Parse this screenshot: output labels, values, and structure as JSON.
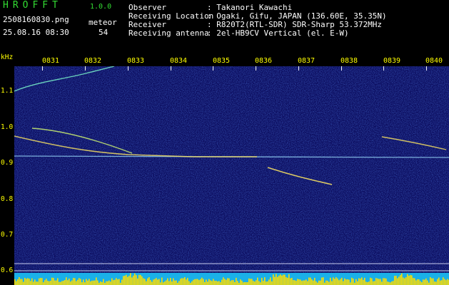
{
  "header": {
    "logo": "HROFFT",
    "version": "1.0.0",
    "filename": "2508160830.png",
    "datetime": "25.08.16 08:30",
    "meteor_label": "meteor",
    "meteor_count": "54",
    "fields": [
      {
        "label": "Observer",
        "value": ": Takanori Kawachi"
      },
      {
        "label": "Receiving Location",
        "value": ": Ogaki, Gifu, JAPAN (136.60E, 35.35N)"
      },
      {
        "label": "Receiver",
        "value": ": R820T2(RTL-SDR) SDR-Sharp 53.372MHz"
      },
      {
        "label": "Receiving antenna",
        "value": ": 2el-HB9CV Vertical (el. E-W)"
      }
    ]
  },
  "axis": {
    "unit": "kHz",
    "y_ticks": [
      "1.1",
      "1.0",
      "0.9",
      "0.8",
      "0.7",
      "0.6"
    ],
    "x_ticks": [
      "0831",
      "0832",
      "0833",
      "0834",
      "0835",
      "0836",
      "0837",
      "0838",
      "0839",
      "0840"
    ]
  },
  "colors": {
    "background": "#000000",
    "spectrogram_bg": "#0a0a6a",
    "text_yellow": "#ffff00",
    "text_white": "#ffffff",
    "logo_green": "#33dd33",
    "carrier_line": "#a8e8ff",
    "meteor_trace": "#ffee66",
    "level_bar": "#ffdd00"
  }
}
